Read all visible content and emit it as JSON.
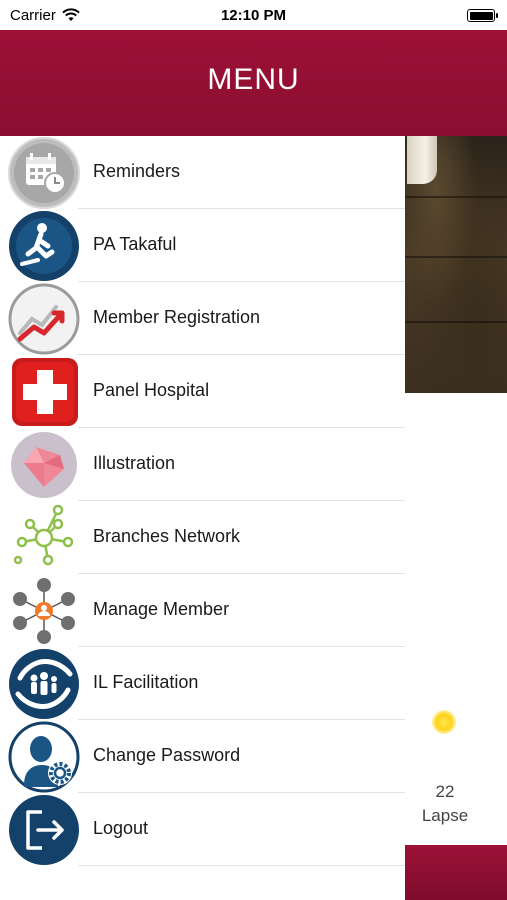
{
  "status_bar": {
    "carrier": "Carrier",
    "time": "12:10 PM"
  },
  "header": {
    "title": "MENU",
    "color": "#9d1137"
  },
  "menu": {
    "items": [
      {
        "label": "Reminders",
        "icon": "calendar-clock-icon"
      },
      {
        "label": "PA Takaful",
        "icon": "person-slipping-icon"
      },
      {
        "label": "Member Registration",
        "icon": "trend-chart-icon"
      },
      {
        "label": "Panel Hospital",
        "icon": "medical-cross-icon"
      },
      {
        "label": "Illustration",
        "icon": "gem-icon"
      },
      {
        "label": "Branches Network",
        "icon": "network-nodes-icon"
      },
      {
        "label": "Manage Member",
        "icon": "people-network-icon"
      },
      {
        "label": "IL Facilitation",
        "icon": "family-hands-icon"
      },
      {
        "label": "Change Password",
        "icon": "user-gear-icon"
      },
      {
        "label": "Logout",
        "icon": "logout-icon"
      }
    ]
  },
  "background": {
    "count": "22",
    "count_label": "Lapse"
  }
}
